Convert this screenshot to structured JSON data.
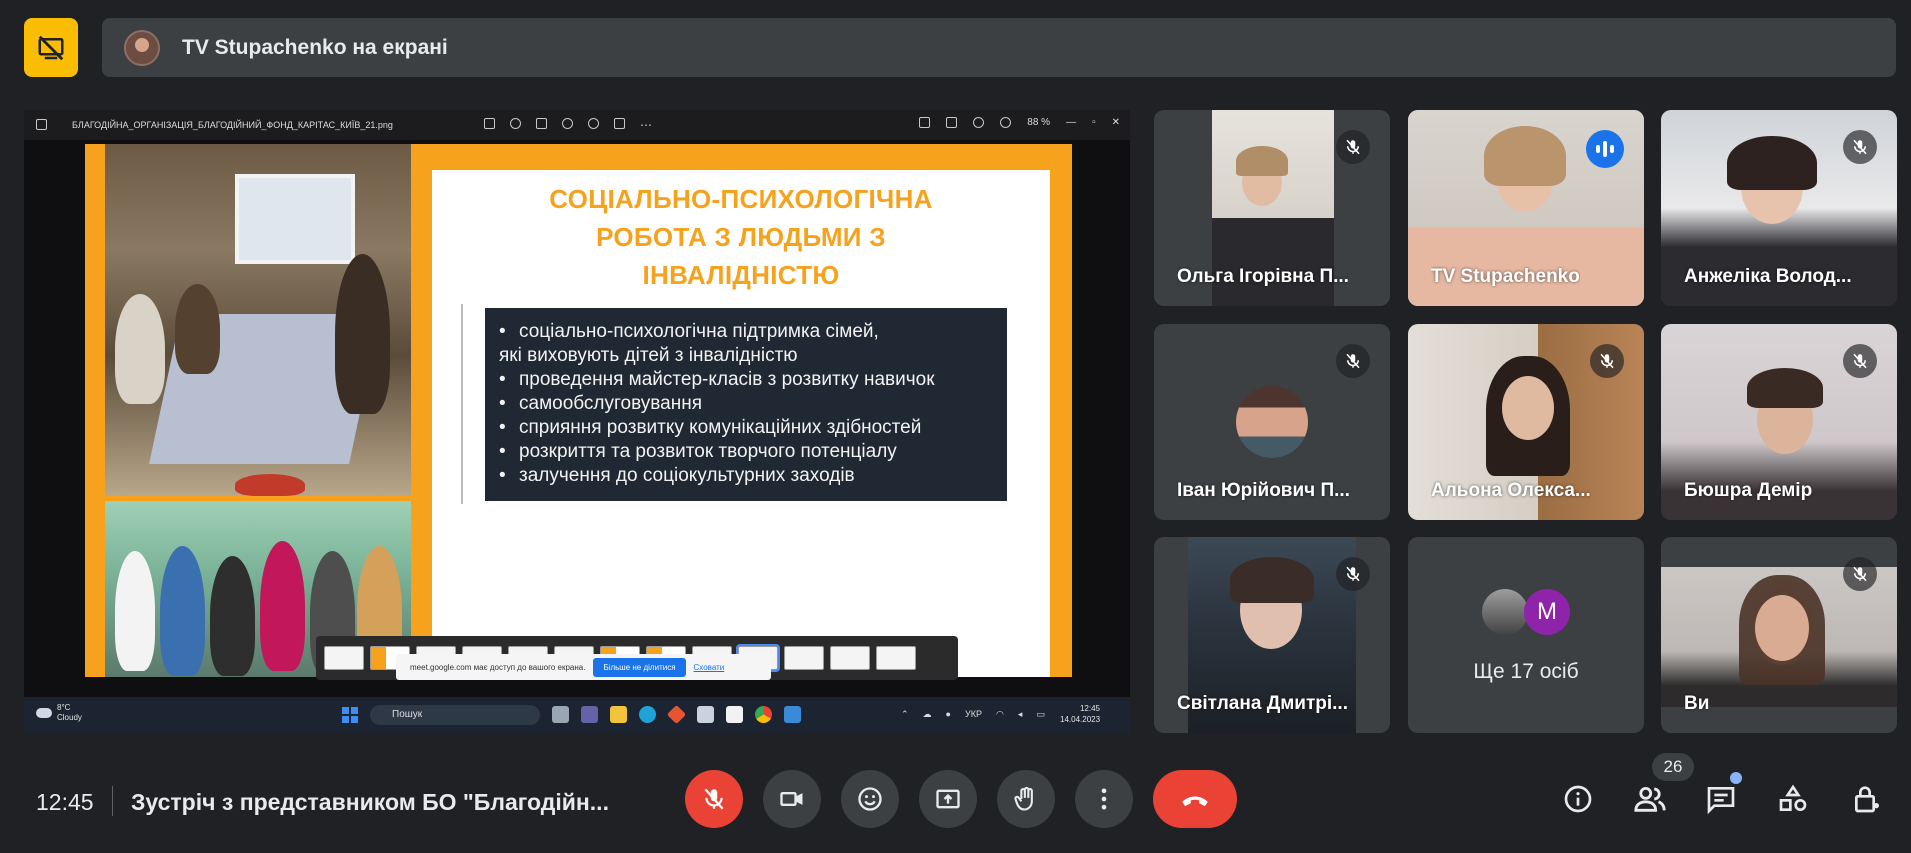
{
  "presenting_banner": {
    "text": "TV Stupachenko на екрані"
  },
  "shared_screen": {
    "viewer": {
      "filename": "БЛАГОДІЙНА_ОРГАНІЗАЦІЯ_БЛАГОДІЙНИЙ_ФОНД_КАРІТАС_КИЇВ_21.png",
      "zoom": "88 %"
    },
    "slide": {
      "title_lines": [
        "СОЦІАЛЬНО-ПСИХОЛОГІЧНА",
        "РОБОТА З ЛЮДЬМИ З",
        "ІНВАЛІДНІСТЮ"
      ],
      "bullets": [
        "соціально-психологічна підтримка сімей,",
        "які виховують дітей з інвалідністю",
        "проведення майстер-класів з розвитку навичок",
        "самообслуговування",
        "сприяння розвитку комунікаційних здібностей",
        "розкриття та розвиток творчого потенціалу",
        "залучення до соціокультурних заходів"
      ]
    },
    "share_notice": {
      "text": "meet.google.com має доступ до вашого екрана.",
      "stop_label": "Більше не ділитися",
      "hide_label": "Сховати"
    },
    "taskbar": {
      "temp": "8°C",
      "weather": "Cloudy",
      "search": "Пошук",
      "lang": "УКР",
      "time": "12:45",
      "date": "14.04.2023"
    }
  },
  "participants": [
    {
      "name": "Ольга Ігорівна П...",
      "muted": true
    },
    {
      "name": "TV Stupachenko",
      "muted": false,
      "speaking": true
    },
    {
      "name": "Анжеліка Волод...",
      "muted": true
    },
    {
      "name": "Іван Юрійович П...",
      "muted": true
    },
    {
      "name": "Альона Олекса...",
      "muted": true
    },
    {
      "name": "Бюшра Демір",
      "muted": true
    },
    {
      "name": "Світлана Дмитрі...",
      "muted": true
    },
    {
      "more_text": "Ще 17 осіб",
      "avatar_letter": "M"
    },
    {
      "name": "Ви",
      "muted": true
    }
  ],
  "bottom_bar": {
    "time": "12:45",
    "meeting_title": "Зустріч з представником БО \"Благодійн...",
    "participants_count": "26"
  },
  "colors": {
    "accent": "#8ab4f8",
    "danger": "#ea4335",
    "present": "#fbbc04",
    "slide_orange": "#f7a21d"
  }
}
